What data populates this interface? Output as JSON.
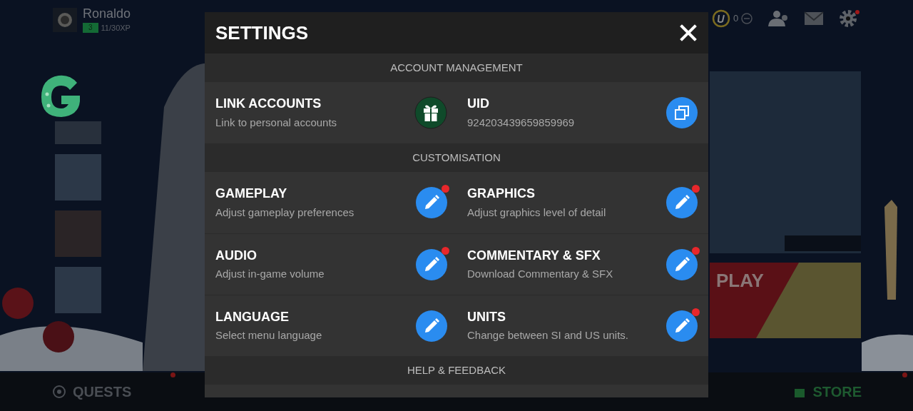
{
  "profile": {
    "name": "Ronaldo",
    "level": "3",
    "xp": "11/30XP"
  },
  "top_bar": {
    "coins": "0",
    "settings_notification": true
  },
  "banner": {
    "label": "PLAY"
  },
  "settings": {
    "title": "SETTINGS",
    "sections": [
      {
        "title": "ACCOUNT MANAGEMENT",
        "items": [
          {
            "kind": "gift",
            "title": "LINK ACCOUNTS",
            "subtitle": "Link to personal accounts",
            "notification": false
          },
          {
            "kind": "copy",
            "title": "UID",
            "subtitle": "924203439659859969",
            "notification": false
          }
        ]
      },
      {
        "title": "CUSTOMISATION",
        "items": [
          {
            "kind": "edit",
            "title": "GAMEPLAY",
            "subtitle": "Adjust gameplay preferences",
            "notification": true
          },
          {
            "kind": "edit",
            "title": "GRAPHICS",
            "subtitle": "Adjust graphics level of detail",
            "notification": true
          },
          {
            "kind": "edit",
            "title": "AUDIO",
            "subtitle": "Adjust in-game volume",
            "notification": true
          },
          {
            "kind": "edit",
            "title": "COMMENTARY & SFX",
            "subtitle": "Download Commentary & SFX",
            "notification": true
          },
          {
            "kind": "edit",
            "title": "LANGUAGE",
            "subtitle": "Select menu language",
            "notification": false
          },
          {
            "kind": "edit",
            "title": "UNITS",
            "subtitle": "Change between SI and US units.",
            "notification": true
          }
        ]
      },
      {
        "title": "HELP & FEEDBACK"
      }
    ]
  },
  "bottom_nav": [
    {
      "label": "QUESTS",
      "notification": true
    },
    {
      "label": "STORE",
      "notification": true
    }
  ]
}
